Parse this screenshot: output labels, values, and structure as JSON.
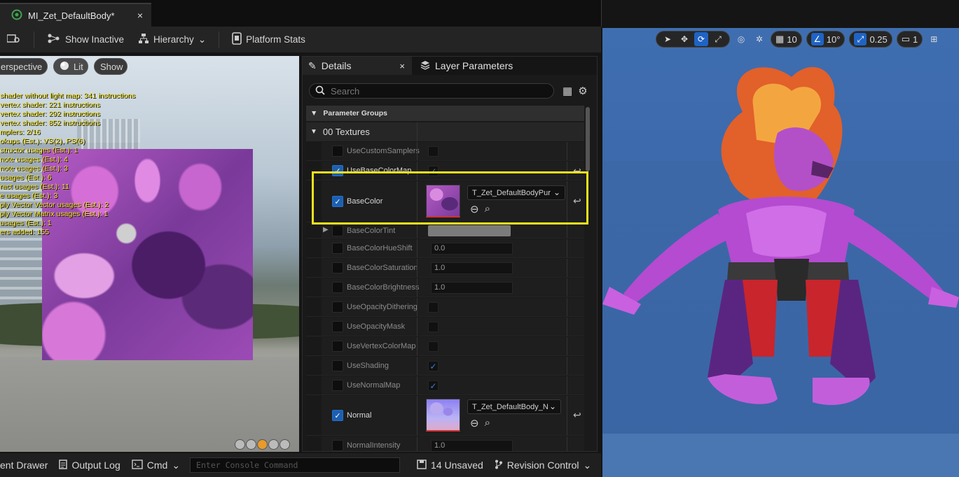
{
  "window": {
    "tab_title": "MI_Zet_DefaultBody*",
    "close_glyph": "×"
  },
  "toolbar": {
    "show_inactive": "Show Inactive",
    "hierarchy": "Hierarchy",
    "platform_stats": "Platform Stats"
  },
  "viewport": {
    "perspective": "erspective",
    "lit": "Lit",
    "show": "Show",
    "stats_lines": [
      "shader without light map: 341 instructions",
      "vertex shader: 221 instructions",
      "vertex shader: 292 instructions",
      "vertex shader: 852 instructions",
      "mplers: 2/16",
      "okups (Est.): VS(2), PS(6)",
      "structor usages (Est.): 1",
      "note usages (Est.): 4",
      "note usages (Est.): 3",
      "usages (Est.): 6",
      "ract usages (Est.): 11",
      "e usages (Est.): 3",
      "ply Vector Vector usages (Est.): 2",
      "ply Vector Matrix usages (Est.): 1",
      "usages (Est.): 1",
      "ers added: 155"
    ]
  },
  "details": {
    "tab_details": "Details",
    "tab_layer_parameters": "Layer Parameters",
    "search_placeholder": "Search",
    "parameter_groups": "Parameter Groups",
    "category": "00 Textures",
    "rows": {
      "use_custom_samplers": "UseCustomSamplers",
      "use_base_color_map": "UseBaseColorMap",
      "base_color": "BaseColor",
      "base_color_asset": "T_Zet_DefaultBodyPur",
      "base_color_tint": "BaseColorTint",
      "base_color_hue_shift": "BaseColorHueShift",
      "base_color_hue_shift_value": "0.0",
      "base_color_saturation": "BaseColorSaturation",
      "base_color_saturation_value": "1.0",
      "base_color_brightness": "BaseColorBrightness",
      "base_color_brightness_value": "1.0",
      "use_opacity_dithering": "UseOpacityDithering",
      "use_opacity_mask": "UseOpacityMask",
      "use_vertex_color_map": "UseVertexColorMap",
      "use_shading": "UseShading",
      "use_normal_map": "UseNormalMap",
      "normal": "Normal",
      "normal_asset": "T_Zet_DefaultBody_N",
      "normal_intensity": "NormalIntensity",
      "normal_intensity_value": "1.0"
    }
  },
  "statusbar": {
    "content_drawer": "ent Drawer",
    "output_log": "Output Log",
    "cmd": "Cmd",
    "console_placeholder": "Enter Console Command",
    "unsaved": "14 Unsaved",
    "revision_control": "Revision Control"
  },
  "right_viewport": {
    "grid_value": "10",
    "angle_value": "10°",
    "scale_value": "0.25",
    "camera_speed": "1"
  },
  "colors": {
    "highlight": "#f3e21c",
    "checkbox_on": "#1c5fb2",
    "viewport_blue": "#3b68aa"
  }
}
